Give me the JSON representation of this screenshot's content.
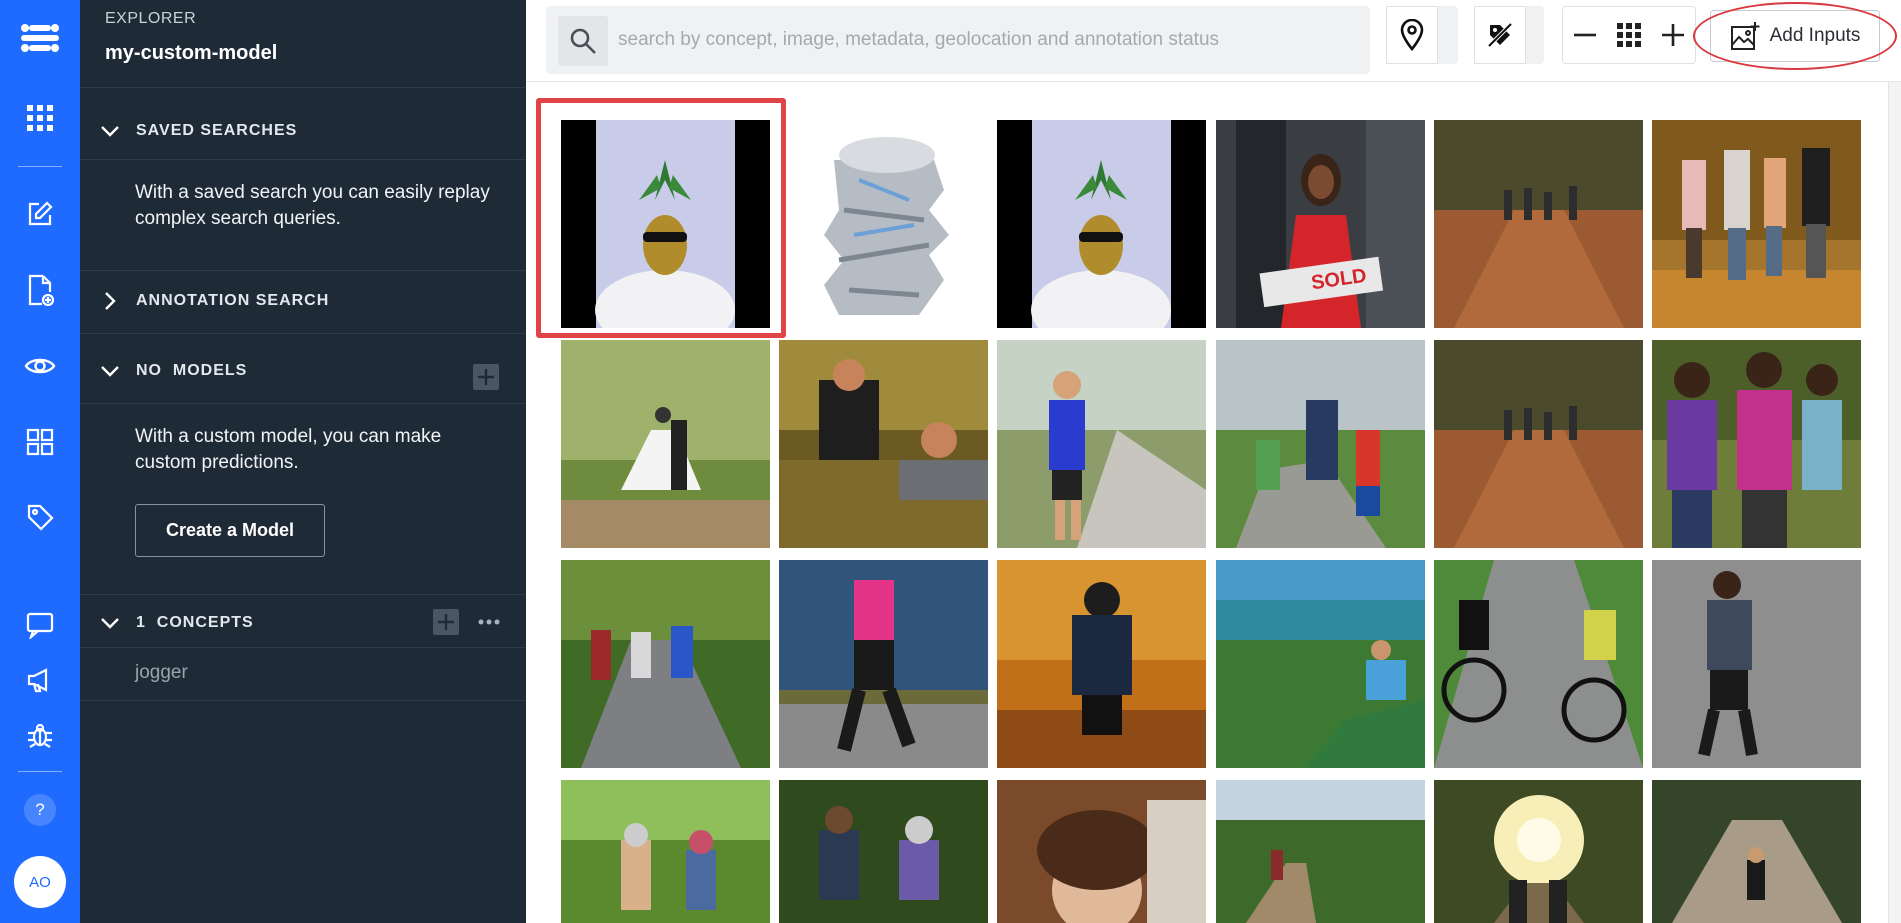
{
  "sidebar": {
    "section_label": "EXPLORER",
    "app_name": "my-custom-model",
    "saved_searches": {
      "title": "SAVED SEARCHES",
      "description": "With a saved search you can easily replay complex search queries."
    },
    "annotation_search": {
      "title": "ANNOTATION SEARCH"
    },
    "models": {
      "count": "NO",
      "title": "MODELS",
      "description": "With a custom model, you can make custom predictions.",
      "create_button": "Create a Model"
    },
    "concepts": {
      "count": "1",
      "title": "CONCEPTS",
      "items": [
        "jogger"
      ]
    }
  },
  "rail": {
    "avatar_initials": "AO",
    "help": "?",
    "items": [
      "logo-icon",
      "apps-grid-icon",
      "edit-icon",
      "add-file-icon",
      "eye-icon",
      "dashboard-icon",
      "tag-icon",
      "chat-icon",
      "megaphone-icon",
      "bug-icon"
    ]
  },
  "toolbar": {
    "search_placeholder": "search by concept, image, metadata, geolocation and annotation status",
    "add_inputs_label": "Add Inputs"
  },
  "colors": {
    "rail": "#1f6bff",
    "sidebar": "#1f2a37",
    "highlight": "#e04447"
  },
  "grid": {
    "tiles": [
      {
        "subject": "pineapple-with-sunglasses",
        "selected": true
      },
      {
        "subject": "crushed-can"
      },
      {
        "subject": "pineapple-with-sunglasses"
      },
      {
        "subject": "woman-with-sold-sign",
        "sign_text": "SOLD"
      },
      {
        "subject": "people-walking-in-park"
      },
      {
        "subject": "people-walking-autumn"
      },
      {
        "subject": "wedding-couple"
      },
      {
        "subject": "couple-lying-in-grass"
      },
      {
        "subject": "woman-jogging"
      },
      {
        "subject": "family-walking"
      },
      {
        "subject": "people-walking-in-park"
      },
      {
        "subject": "women-jogging-group"
      },
      {
        "subject": "people-jogging-path"
      },
      {
        "subject": "jogger-by-water"
      },
      {
        "subject": "person-autumn-forest"
      },
      {
        "subject": "man-on-coast"
      },
      {
        "subject": "cyclists"
      },
      {
        "subject": "woman-running"
      },
      {
        "subject": "people-jogging-forest"
      },
      {
        "subject": "joggers-trail"
      },
      {
        "subject": "woman-in-leaves"
      },
      {
        "subject": "hiker-in-woods"
      },
      {
        "subject": "joggers-sunlight"
      },
      {
        "subject": "runner-on-path"
      }
    ]
  }
}
